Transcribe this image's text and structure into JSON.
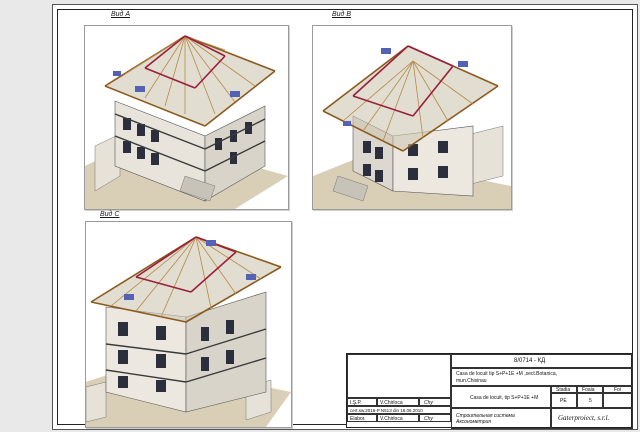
{
  "views": [
    {
      "label": "Вид А"
    },
    {
      "label": "Вид В"
    },
    {
      "label": "Вид С"
    }
  ],
  "title_block": {
    "project_code": "8/0714 - КД",
    "project_title": "Casa de locuit tip  S+P+1E +M ,sect.Botanica,",
    "project_location": "mun.Chisinau",
    "sheet_title": "Casa de locuit, tip S+P+1E +M",
    "col_stadia": "Stadia",
    "col_foaia": "Foaia",
    "col_foi": "Foi",
    "val_stadia": "PE",
    "val_foaia": "5",
    "val_foi": "",
    "row1_role": "I.Ş.P.",
    "row1_name": "V.Chirloca",
    "row1_sign": "Chy",
    "license": "cert.sw.2016-P N513 din 16.06.2010",
    "row2_role": "Elabor.",
    "row2_name": "V.Chirloca",
    "row2_sign": "Chy",
    "drawing_name": "Строительная система",
    "drawing_sub": "Аксонометрия",
    "company": "Gaterproiect, s.r.l."
  }
}
